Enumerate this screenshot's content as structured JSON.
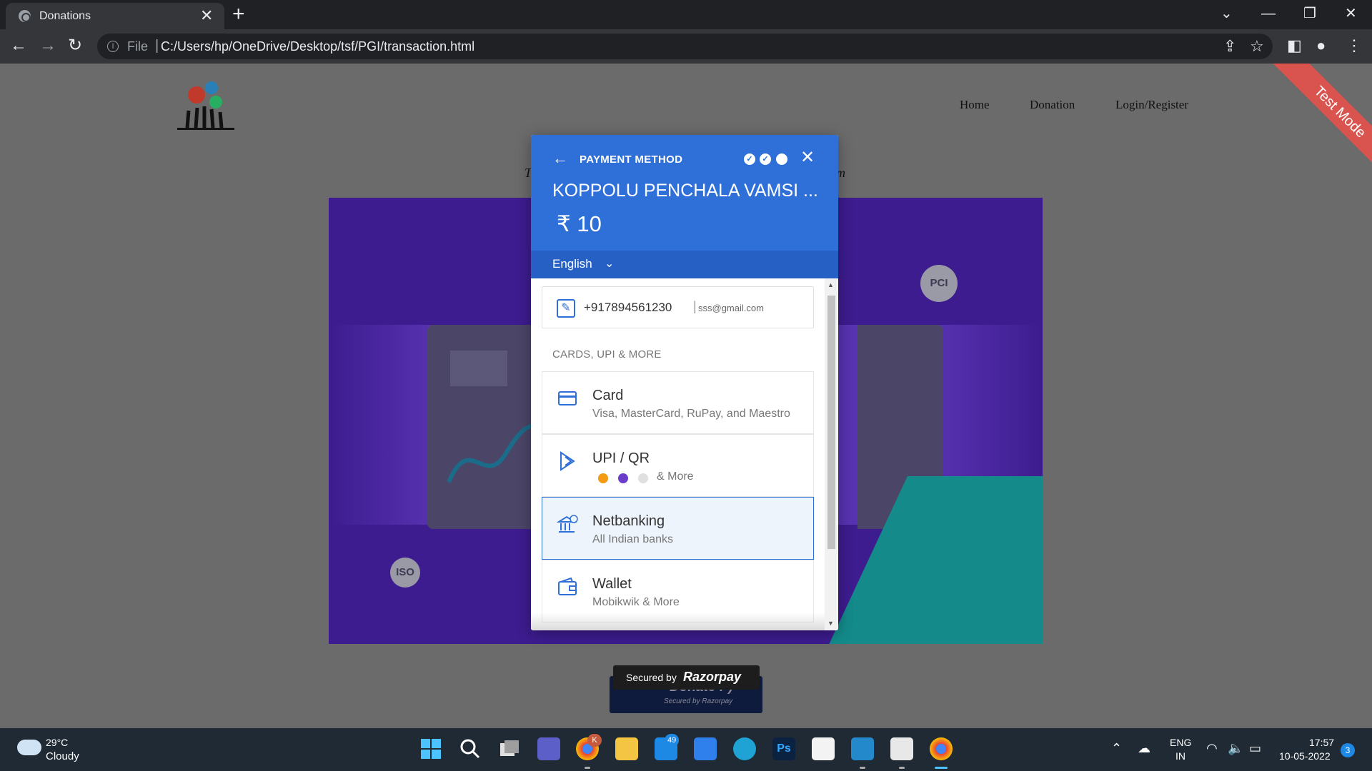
{
  "browser": {
    "tab_title": "Donations",
    "close_glyph": "✕",
    "new_tab_glyph": "+",
    "file_label": "File",
    "url_sep": "|",
    "url": "C:/Users/hp/OneDrive/Desktop/tsf/PGI/transaction.html",
    "icons": [
      "back-icon",
      "forward-icon",
      "reload-icon",
      "info-icon",
      "share-icon",
      "star-icon",
      "sidepanel-icon",
      "profile-icon",
      "menu-icon"
    ]
  },
  "site": {
    "nav": [
      "Home",
      "Donation",
      "Login/Register"
    ],
    "subtitle_left": "T",
    "subtitle_right": "m",
    "badge_pci": "PCI",
    "badge_iso": "ISO",
    "donate_label": "Donate :-)",
    "donate_sub": "Secured by Razorpay",
    "secured_by": "Secured by",
    "secured_brand": "Razorpay",
    "ribbon": "Test Mode"
  },
  "checkout": {
    "header_title": "PAYMENT METHOD",
    "merchant_name": "KOPPOLU PENCHALA VAMSI ...",
    "amount": "₹ 10",
    "language": "English",
    "phone": "+917894561230",
    "email": "sss@gmail.com",
    "section_label": "CARDS, UPI & MORE",
    "methods": [
      {
        "title": "Card",
        "subtitle": "Visa, MasterCard, RuPay, and Maestro",
        "icon": "card-icon"
      },
      {
        "title": "UPI / QR",
        "subtitle": "& More",
        "icon": "upi-icon"
      },
      {
        "title": "Netbanking",
        "subtitle": "All Indian banks",
        "icon": "bank-icon",
        "selected": true
      },
      {
        "title": "Wallet",
        "subtitle": "Mobikwik & More",
        "icon": "wallet-icon"
      }
    ],
    "accent_color": "#2f6fd8"
  },
  "taskbar": {
    "temperature": "29°C",
    "weather": "Cloudy",
    "mail_badge": "49",
    "chrome_badge": "K",
    "lang_line1": "ENG",
    "lang_line2": "IN",
    "time": "17:57",
    "date": "10-05-2022",
    "notifications": "3"
  }
}
